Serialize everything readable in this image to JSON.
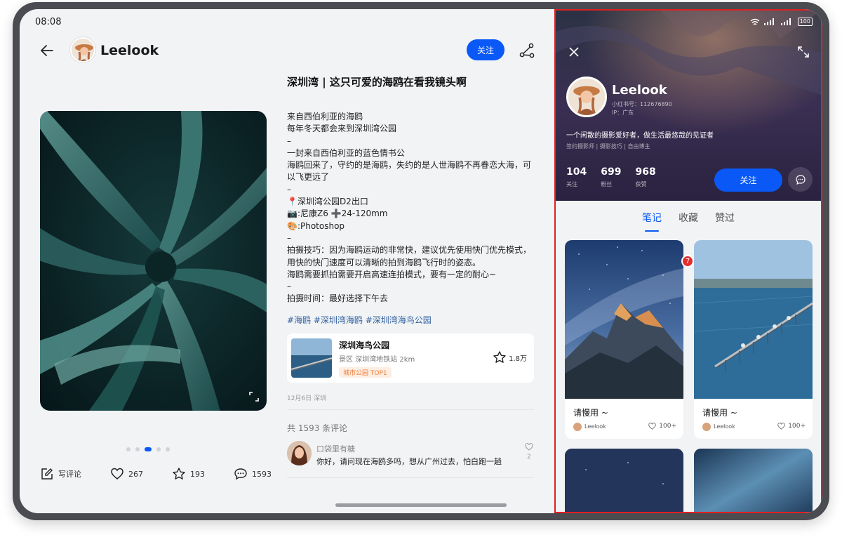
{
  "status_bar": {
    "time": "08:08",
    "battery": "100"
  },
  "post_view": {
    "author": "Leelook",
    "follow_label": "关注",
    "title": "深圳湾 | 这只可爱的海鸥在看我镜头啊",
    "body_lines": [
      "来自西伯利亚的海鸥",
      "每年冬天都会来到深圳湾公园",
      "–",
      "一封来自西伯利亚的蓝色情书公",
      "海鸥回来了，守约的是海鸥，失约的是人世海鸥不再眷恋大海，可以飞更远了",
      "–",
      "📍深圳湾公园D2出口",
      "📷:尼康Z6 ➕24-120mm",
      "🎨:Photoshop",
      "–",
      "拍摄技巧：因为海鸥运动的非常快，建议优先使用快门优先模式，用快的快门速度可以清晰的拍到海鸥飞行时的姿态。",
      "海鸥需要抓拍需要开启高速连拍模式，要有一定的耐心~",
      "–",
      "拍摄时间：最好选择下午去"
    ],
    "tags": "#海鸥 #深圳湾海鸥 #深圳湾海鸟公园",
    "place": {
      "name": "深圳海鸟公园",
      "sub": "景区 深圳湾地铁站 2km",
      "badge": "城市公园 TOP1",
      "stars": "1.8万"
    },
    "date": "12月6日 深圳",
    "comment_count": "共 1593 条评论",
    "comment": {
      "name": "口袋里有糖",
      "text": "你好，请问现在海鸥多吗，想从广州过去，怕白跑一趟",
      "likes": "2"
    },
    "actions": {
      "write_comment": "写评论",
      "likes": "267",
      "stars": "193",
      "comments": "1593"
    },
    "carousel": {
      "count": 5,
      "active_index": 2
    }
  },
  "profile": {
    "name": "Leelook",
    "id_line": "小红书号：112676890",
    "ip_line": "IP：广东",
    "bio": "一个闲散的摄影爱好者，做生活最悠哉的见证者",
    "tags": "签约摄影师 | 摄影技巧 | 自由博主",
    "stats": [
      {
        "num": "104",
        "label": "关注"
      },
      {
        "num": "699",
        "label": "粉丝"
      },
      {
        "num": "968",
        "label": "获赞"
      }
    ],
    "follow_label": "关注",
    "tabs": [
      {
        "label": "笔记",
        "active": true
      },
      {
        "label": "收藏",
        "active": false
      },
      {
        "label": "赞过",
        "active": false
      }
    ],
    "notification_count": "7",
    "notes": [
      {
        "title": "请慢用 ~",
        "author": "Leelook",
        "likes": "100+"
      },
      {
        "title": "请慢用 ~",
        "author": "Leelook",
        "likes": "100+"
      }
    ]
  },
  "colors": {
    "accent": "#0a59f7",
    "highlight_border": "#e02020",
    "badge": "#e52d2d"
  },
  "icons": [
    "back-arrow-icon",
    "share-icon",
    "expand-icon",
    "edit-icon",
    "heart-icon",
    "star-icon",
    "comment-icon",
    "close-icon",
    "fullscreen-icon",
    "message-icon",
    "wifi-icon",
    "signal-icon",
    "battery-icon"
  ]
}
